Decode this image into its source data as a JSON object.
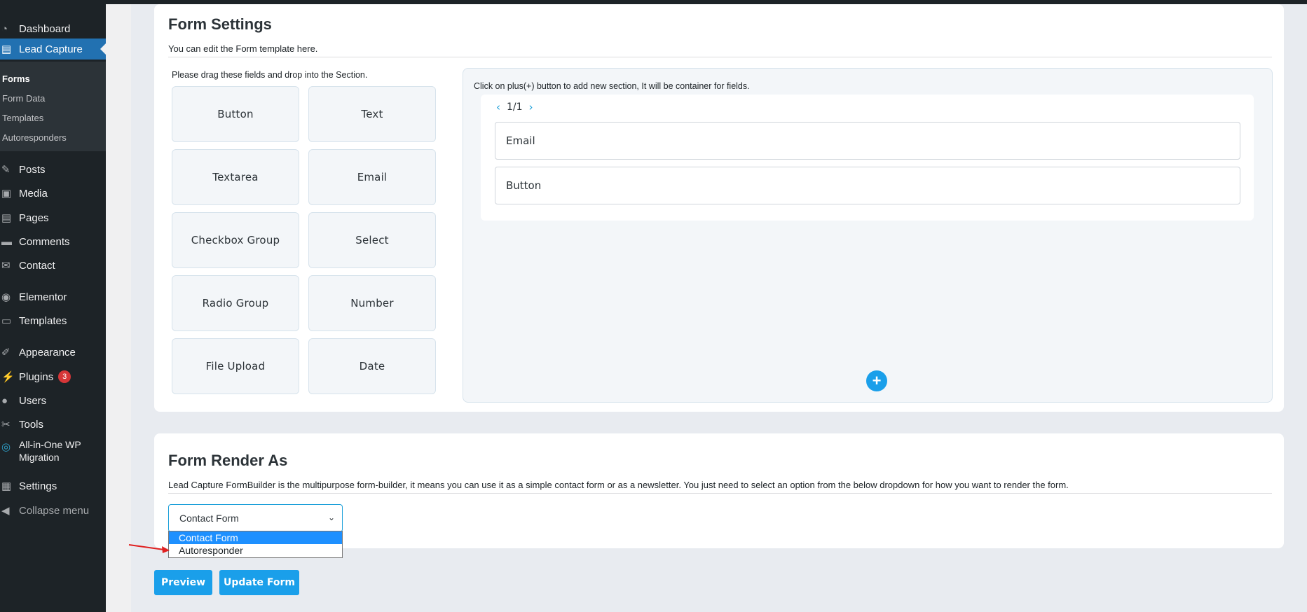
{
  "sidebar": {
    "items": [
      {
        "label": "Dashboard",
        "icon": "dashboard-icon"
      },
      {
        "label": "Lead Capture",
        "icon": "lead-capture-icon",
        "active": true
      },
      {
        "label": "Posts",
        "icon": "pin-icon"
      },
      {
        "label": "Media",
        "icon": "media-icon"
      },
      {
        "label": "Pages",
        "icon": "pages-icon"
      },
      {
        "label": "Comments",
        "icon": "comments-icon"
      },
      {
        "label": "Contact",
        "icon": "envelope-icon"
      },
      {
        "label": "Elementor",
        "icon": "elementor-icon"
      },
      {
        "label": "Templates",
        "icon": "folder-icon"
      },
      {
        "label": "Appearance",
        "icon": "brush-icon"
      },
      {
        "label": "Plugins",
        "icon": "plug-icon",
        "badge": "3"
      },
      {
        "label": "Users",
        "icon": "user-icon"
      },
      {
        "label": "Tools",
        "icon": "wrench-icon"
      },
      {
        "label": "All-in-One WP",
        "label2": "Migration",
        "icon": "migration-icon"
      },
      {
        "label": "Settings",
        "icon": "settings-icon"
      },
      {
        "label": "Collapse menu",
        "icon": "collapse-icon"
      }
    ],
    "submenu": [
      {
        "label": "Forms",
        "current": true
      },
      {
        "label": "Form Data"
      },
      {
        "label": "Templates"
      },
      {
        "label": "Autoresponders"
      }
    ]
  },
  "form_settings": {
    "title": "Form Settings",
    "description": "You can edit the Form template here.",
    "drag_hint": "Please drag these fields and drop into the Section.",
    "fields": [
      "Button",
      "Text",
      "Textarea",
      "Email",
      "Checkbox Group",
      "Select",
      "Radio Group",
      "Number",
      "File Upload",
      "Date"
    ],
    "section_hint": "Click on plus(+) button to add new section, It will be container for fields.",
    "pager": {
      "prev": "‹",
      "label": "1/1",
      "next": "›"
    },
    "section_fields": [
      "Email",
      "Button"
    ],
    "add_section": "+"
  },
  "render_as": {
    "title": "Form Render As",
    "description": "Lead Capture FormBuilder is the multipurpose form-builder, it means you can use it as a simple contact form or as a newsletter. You just need to select an option from the below dropdown for how you want to render the form.",
    "select_value": "Contact Form",
    "options": [
      "Contact Form",
      "Autoresponder"
    ]
  },
  "actions": {
    "preview": "Preview",
    "update": "Update Form"
  },
  "colors": {
    "sidebar_bg": "#1d2327",
    "active": "#2271b1",
    "accent": "#1a9fea",
    "annotation_arrow": "#e02020"
  }
}
